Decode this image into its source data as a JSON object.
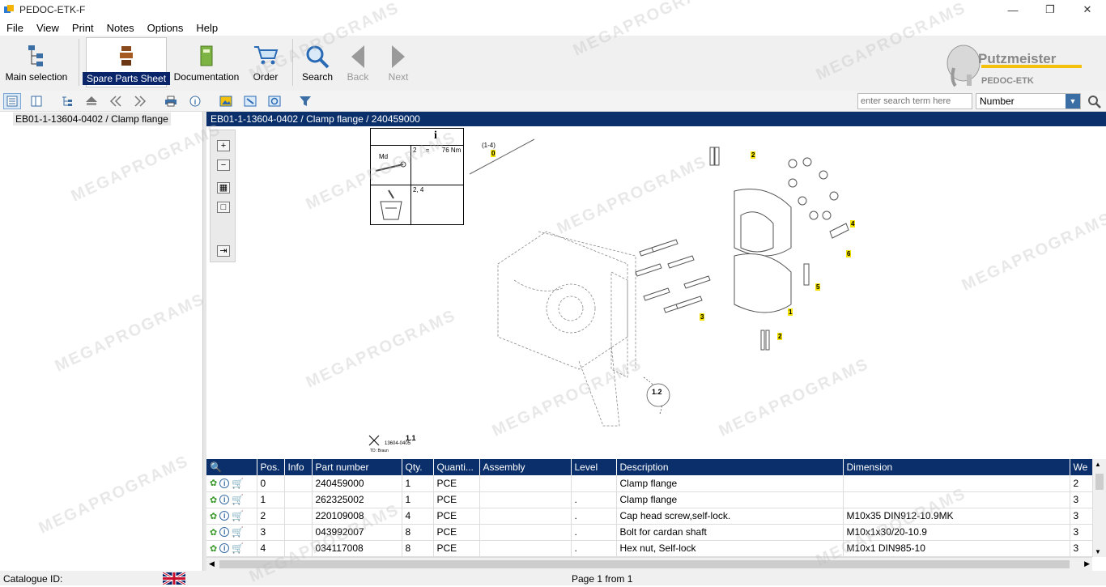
{
  "window": {
    "title": "PEDOC-ETK-F",
    "minimize": "—",
    "restore": "❐",
    "close": "✕"
  },
  "menu": [
    {
      "label": "File"
    },
    {
      "label": "View"
    },
    {
      "label": "Print"
    },
    {
      "label": "Notes"
    },
    {
      "label": "Options"
    },
    {
      "label": "Help"
    }
  ],
  "ribbon": {
    "main_selection": "Main selection",
    "spare_parts_sheet": "Spare Parts Sheet",
    "documentation": "Documentation",
    "order": "Order",
    "search": "Search",
    "back": "Back",
    "next": "Next"
  },
  "logo": {
    "brand": "Putzmeister",
    "product": "PEDOC-ETK"
  },
  "search": {
    "placeholder": "enter search term here",
    "mode": "Number"
  },
  "tree": {
    "node": "EB01-1-13604-0402  /  Clamp flange"
  },
  "path": "EB01-1-13604-0402  /  Clamp flange  /  240459000",
  "drawing": {
    "info_table": {
      "md_label": "Md",
      "row1": "2     =       76 Nm",
      "row2": "2, 4"
    },
    "ref_range": "(1-4)",
    "ref_zero": "0",
    "callouts": [
      "2",
      "4",
      "6",
      "5",
      "1",
      "3",
      "2"
    ],
    "detail_ref": "1.2",
    "sheet_ref": "1.1",
    "sheet_number": "13604-0405",
    "sheet_note": "TD: Braun"
  },
  "grid": {
    "columns": [
      "Pos.",
      "Info",
      "Part number",
      "Qty.",
      "Quanti...",
      "Assembly",
      "Level",
      "Description",
      "Dimension",
      "We"
    ],
    "rows": [
      {
        "pos": "0",
        "part": "240459000",
        "qty": "1",
        "unit": "PCE",
        "level": "",
        "desc": "Clamp flange",
        "dim": "",
        "we": "2"
      },
      {
        "pos": "1",
        "part": "262325002",
        "qty": "1",
        "unit": "PCE",
        "level": ".",
        "desc": "Clamp flange",
        "dim": "",
        "we": "3"
      },
      {
        "pos": "2",
        "part": "220109008",
        "qty": "4",
        "unit": "PCE",
        "level": ".",
        "desc": "Cap head screw,self-lock.",
        "dim": "M10x35 DIN912-10.9MK",
        "we": "3"
      },
      {
        "pos": "3",
        "part": "043992007",
        "qty": "8",
        "unit": "PCE",
        "level": ".",
        "desc": "Bolt for cardan shaft",
        "dim": "M10x1x30/20-10.9",
        "we": "3"
      },
      {
        "pos": "4",
        "part": "034117008",
        "qty": "8",
        "unit": "PCE",
        "level": ".",
        "desc": "Hex nut, Self-lock",
        "dim": "M10x1 DIN985-10",
        "we": "3"
      }
    ]
  },
  "status": {
    "catalogue": "Catalogue ID:",
    "page": "Page 1 from 1"
  },
  "watermark": "MEGAPROGRAMS",
  "colors": {
    "header_bg": "#0a2f6b",
    "accent": "#3a6ea5",
    "active_label": "#0a246a"
  }
}
